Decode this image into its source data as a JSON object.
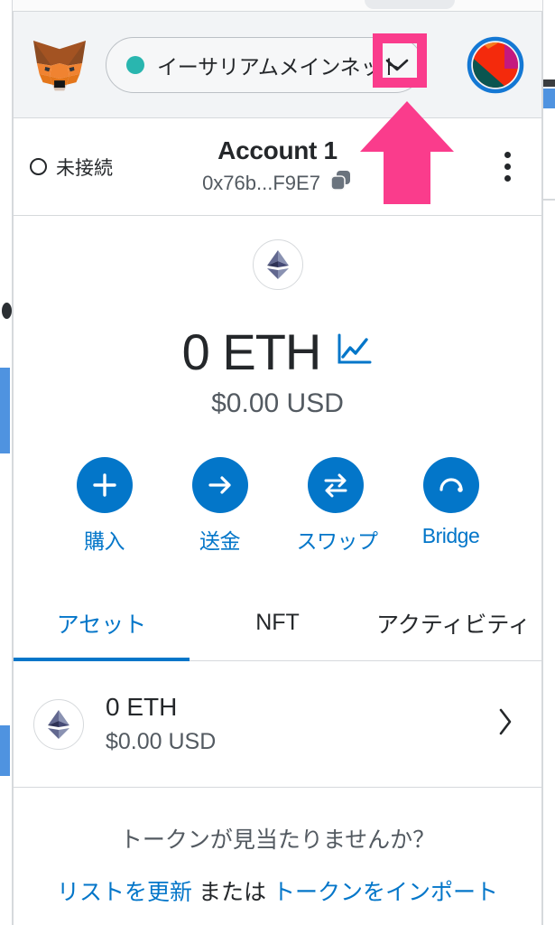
{
  "header": {
    "logo_name": "metamask-fox-logo",
    "network": {
      "name": "イーサリアムメインネット",
      "status_dot_color": "#29b6af",
      "caret_icon": "chevron-down-icon"
    },
    "avatar_name": "account-avatar",
    "background_color": "#f2f4f6"
  },
  "account": {
    "connection_status": "未接続",
    "name": "Account 1",
    "address": "0x76b...F9E7",
    "copy_icon": "copy-icon",
    "menu_icon": "kebab-menu-icon"
  },
  "balance": {
    "token_icon": "ethereum-icon",
    "amount": "0 ETH",
    "fiat": "$0.00 USD",
    "chart_icon": "line-chart-icon"
  },
  "actions": [
    {
      "label": "購入",
      "icon": "plus-icon"
    },
    {
      "label": "送金",
      "icon": "arrow-right-icon"
    },
    {
      "label": "スワップ",
      "icon": "swap-arrows-icon"
    },
    {
      "label": "Bridge",
      "icon": "bridge-arc-icon"
    }
  ],
  "tabs": [
    {
      "label": "アセット",
      "active": true
    },
    {
      "label": "NFT",
      "active": false
    },
    {
      "label": "アクティビティ",
      "active": false
    }
  ],
  "tokens": [
    {
      "icon": "ethereum-icon",
      "amount": "0 ETH",
      "fiat": "$0.00 USD",
      "chevron": "chevron-right-icon"
    }
  ],
  "footer": {
    "question": "トークンが見当たりませんか？",
    "refresh_link": "リストを更新",
    "conjunction": "または",
    "import_link": "トークンをインポート"
  },
  "annotation": {
    "highlight_color": "#fa3c8c",
    "highlight_target": "network-caret",
    "arrow_icon": "up-arrow-annotation"
  },
  "colors": {
    "accent_blue": "#0376c9",
    "text_primary": "#24272a",
    "text_secondary": "#535a61",
    "border": "#d6d9dc",
    "header_bg": "#f2f4f6"
  }
}
